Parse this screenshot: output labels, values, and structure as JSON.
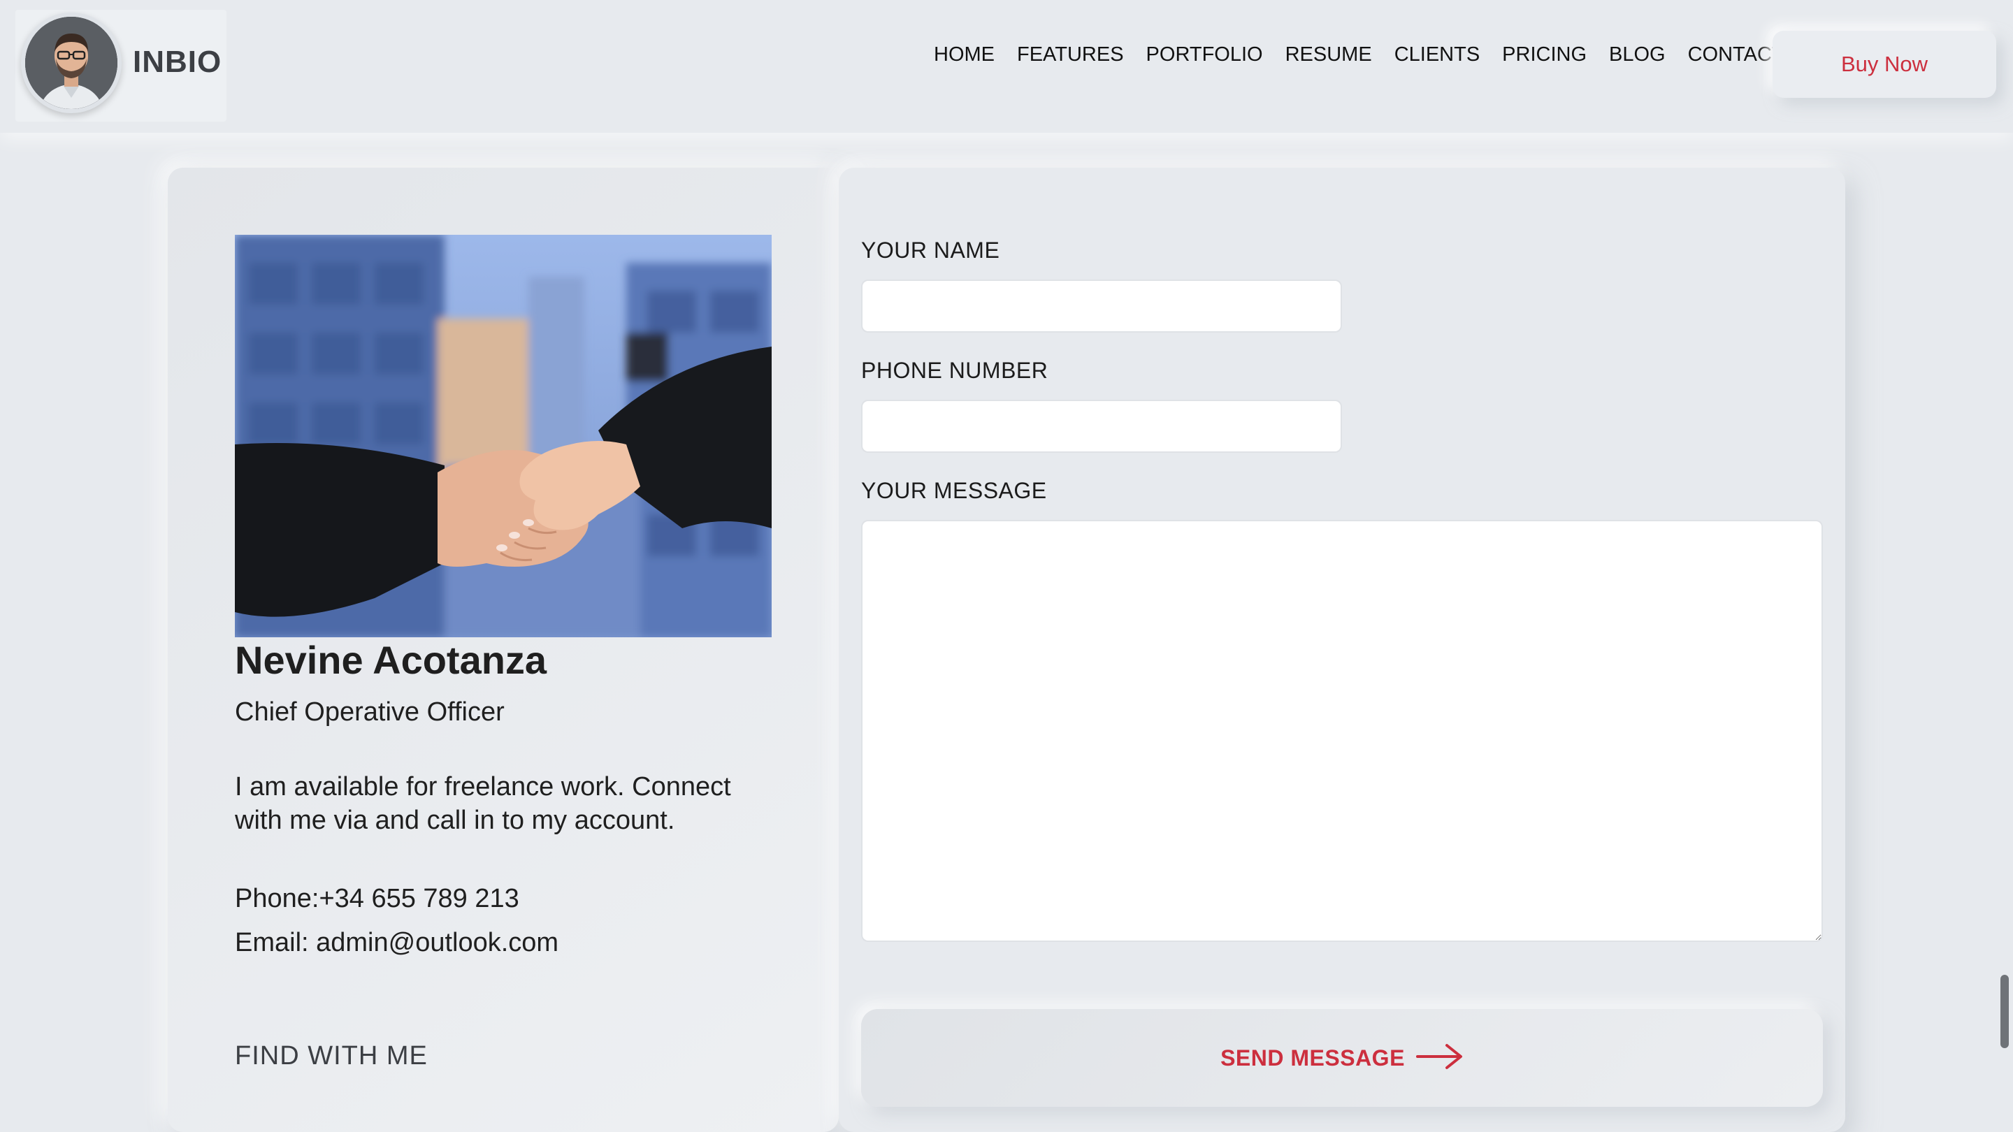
{
  "header": {
    "logo_text": "INBIO",
    "nav": [
      {
        "label": "HOME"
      },
      {
        "label": "FEATURES"
      },
      {
        "label": "PORTFOLIO"
      },
      {
        "label": "RESUME"
      },
      {
        "label": "CLIENTS"
      },
      {
        "label": "PRICING"
      },
      {
        "label": "BLOG"
      },
      {
        "label": "CONTACT"
      }
    ],
    "buy_label": "Buy Now"
  },
  "profile": {
    "name": "Nevine Acotanza",
    "title": "Chief Operative Officer",
    "description": "I am available for freelance work. Connect with me via and call in to my account.",
    "phone": "Phone:+34 655 789 213",
    "email": "Email: admin@outlook.com",
    "find_with_me": "FIND WITH ME"
  },
  "form": {
    "name_label": "YOUR NAME",
    "name_value": "",
    "phone_label": "PHONE NUMBER",
    "phone_value": "",
    "message_label": "YOUR MESSAGE",
    "message_value": "",
    "send_label": "SEND MESSAGE"
  },
  "icons": {
    "send": "arrow-right-icon"
  },
  "colors": {
    "background": "#e7eaee",
    "accent": "#cc2f3e",
    "text": "#1b1b1b"
  }
}
